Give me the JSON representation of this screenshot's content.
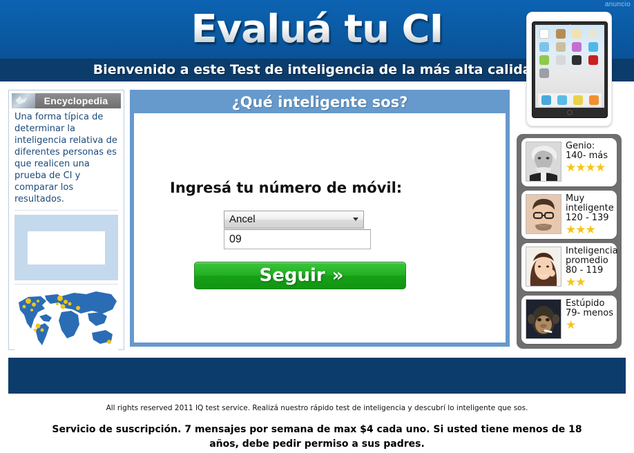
{
  "header": {
    "title": "Evaluá tu CI",
    "welcome": "Bienvenido a este Test de inteligencia de la más alta calidad",
    "ad_label": "anuncio"
  },
  "encyclopedia": {
    "heading": "Encyclopedia",
    "body": "Una forma típica de determinar la inteligencia relativa de diferentes personas es que realicen una prueba de CI y comparar los resultados."
  },
  "form": {
    "panel_title": "¿Qué inteligente sos?",
    "label": "Ingresá tu número de móvil:",
    "carrier_value": "Ancel",
    "carrier_options": [
      "Ancel"
    ],
    "phone_value": "09",
    "phone_placeholder": "",
    "submit_label": "Seguir",
    "submit_chevron": "»"
  },
  "iq_levels": [
    {
      "name": "Genio:",
      "range": "140- más",
      "stars": "★★★★",
      "photo": "einstein-photo"
    },
    {
      "name": "Muy",
      "name2": "inteligente",
      "range": "120 - 139",
      "stars": "★★★",
      "photo": "man-glasses-photo"
    },
    {
      "name": "Inteligencia",
      "name2": "promedio",
      "range": "80 - 119",
      "stars": "★★",
      "photo": "woman-smiling-photo"
    },
    {
      "name": "Estúpido",
      "range": "79- menos",
      "stars": "★",
      "photo": "chimp-photo"
    }
  ],
  "footer": {
    "small": "All rights reserved 2011 IQ test service. Realizá nuestro rápido test de inteligencia y descubrí lo inteligente que sos.",
    "bold": "Servicio de suscripción. 7 mensajes por semana de max $4 cada uno. Si usted tiene menos de 18 años, debe pedir permiso a sus padres."
  },
  "colors": {
    "top_blue": "#0a5aa3",
    "navy": "#0b3c6b",
    "panel_blue": "#6699cc",
    "button_green": "#22b022",
    "star_gold": "#f5c518",
    "sidebar_gray": "#6f6f6f"
  }
}
